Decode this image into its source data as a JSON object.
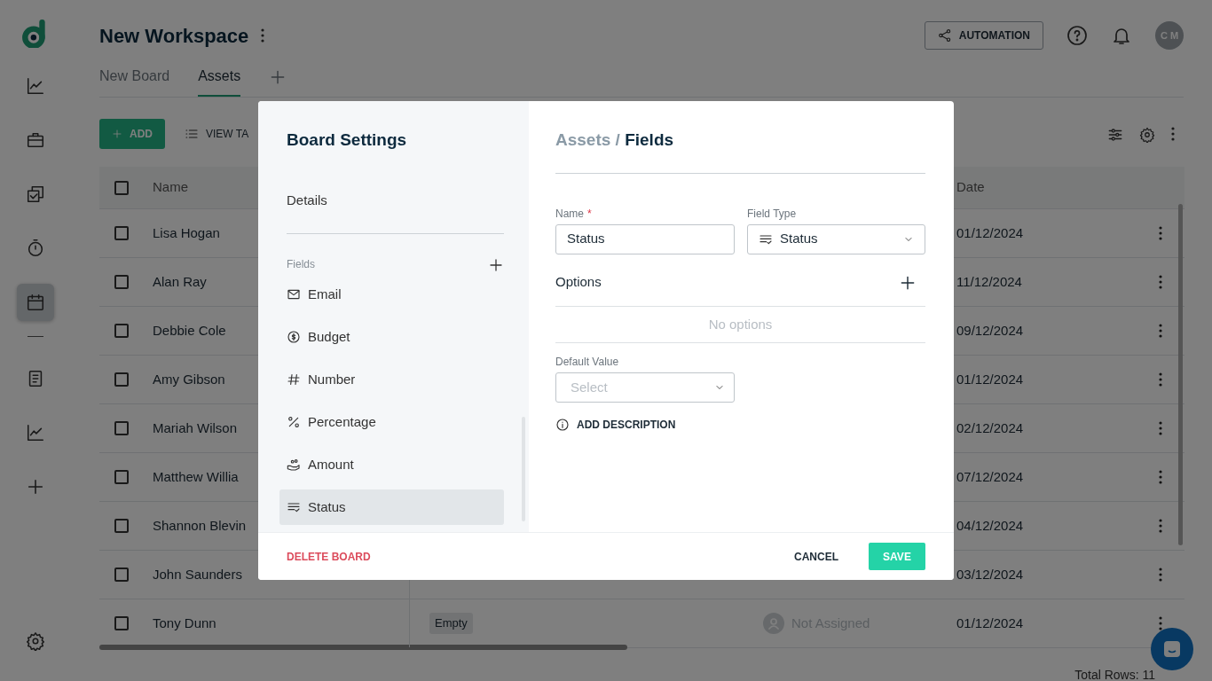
{
  "sidebar": {
    "items": [
      {
        "kind": "chart",
        "selected": false
      },
      {
        "kind": "briefcase",
        "selected": false
      },
      {
        "kind": "checklist",
        "selected": false
      },
      {
        "kind": "timer",
        "selected": false
      },
      {
        "kind": "calendar",
        "selected": true
      },
      {
        "kind": "divider"
      },
      {
        "kind": "document",
        "selected": false
      },
      {
        "kind": "chart",
        "selected": false
      },
      {
        "kind": "plus",
        "selected": false
      }
    ]
  },
  "header": {
    "title": "New Workspace",
    "automation_button": "AUTOMATION",
    "avatar": "C M"
  },
  "tabs": [
    {
      "label": "New Board",
      "selected": false
    },
    {
      "label": "Assets",
      "selected": true
    }
  ],
  "toolbar": {
    "add_button": "ADD",
    "view_button": "VIEW TA"
  },
  "table": {
    "columns": [
      "Name",
      "Date"
    ],
    "select_all_checked": false,
    "rows": [
      {
        "name": "Lisa Hogan",
        "date": "01/12/2024",
        "checked": false
      },
      {
        "name": "Alan Ray",
        "date": "11/12/2024",
        "checked": false
      },
      {
        "name": "Debbie Cole",
        "date": "09/12/2024",
        "checked": false
      },
      {
        "name": "Amy Gibson",
        "date": "01/12/2024",
        "checked": false
      },
      {
        "name": "Mariah Wilson",
        "date": "02/12/2024",
        "checked": false
      },
      {
        "name": "Matthew Willia",
        "date": "07/12/2024",
        "checked": false
      },
      {
        "name": "Shannon Blevin",
        "date": "04/12/2024",
        "checked": false
      },
      {
        "name": "John Saunders",
        "date": "03/12/2024",
        "checked": false
      },
      {
        "name": "Tony Dunn",
        "tag": "Empty",
        "assignee": "Not Assigned",
        "date": "01/12/2024",
        "checked": false
      }
    ]
  },
  "footer": {
    "total_rows": "Total Rows: 11"
  },
  "modal": {
    "title": "Board Settings",
    "details": "Details",
    "fields_label": "Fields",
    "fields": [
      {
        "label": "Email",
        "kind": "email",
        "selected": false
      },
      {
        "label": "Budget",
        "kind": "budget",
        "selected": false
      },
      {
        "label": "Number",
        "kind": "number",
        "selected": false
      },
      {
        "label": "Percentage",
        "kind": "percentage",
        "selected": false
      },
      {
        "label": "Amount",
        "kind": "amount",
        "selected": false
      },
      {
        "label": "Status",
        "kind": "status",
        "selected": true
      }
    ],
    "breadcrumb": {
      "parent": "Assets /",
      "current": "Fields"
    },
    "name_label": "Name",
    "required_mark": "*",
    "name_value": "Status",
    "field_type_label": "Field Type",
    "field_type_value": "Status",
    "options_label": "Options",
    "options_empty": "No options",
    "default_label": "Default Value",
    "default_placeholder": "Select",
    "add_description": "ADD DESCRIPTION",
    "delete_button": "DELETE BOARD",
    "cancel_button": "CANCEL",
    "save_button": "SAVE"
  }
}
